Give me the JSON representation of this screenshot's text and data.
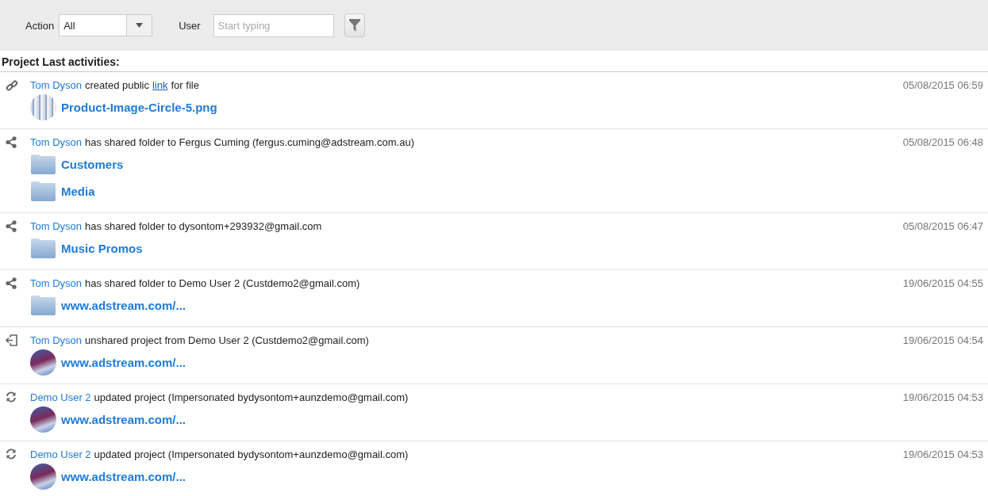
{
  "filters": {
    "action_label": "Action",
    "action_value": "All",
    "user_label": "User",
    "user_placeholder": "Start typing"
  },
  "section_title": "Project Last activities:",
  "activities": [
    {
      "kind": "link",
      "actor": "Tom Dyson",
      "message": [
        {
          "kind": "text",
          "text": "created public"
        },
        {
          "kind": "link",
          "text": "link"
        },
        {
          "kind": "text",
          "text": "for file"
        }
      ],
      "time": "05/08/2015 06:59",
      "items": [
        {
          "kind": "file",
          "name": "Product-Image-Circle-5.png"
        }
      ]
    },
    {
      "kind": "share",
      "actor": "Tom Dyson",
      "message": [
        {
          "kind": "text",
          "text": "has shared folder to Fergus Cuming (fergus.cuming@adstream.com.au)"
        }
      ],
      "time": "05/08/2015 06:48",
      "items": [
        {
          "kind": "folder",
          "name": "Customers"
        },
        {
          "kind": "folder",
          "name": "Media"
        }
      ]
    },
    {
      "kind": "share",
      "actor": "Tom Dyson",
      "message": [
        {
          "kind": "text",
          "text": "has shared folder to dysontom+293932@gmail.com"
        }
      ],
      "time": "05/08/2015 06:47",
      "items": [
        {
          "kind": "folder",
          "name": "Music Promos"
        }
      ]
    },
    {
      "kind": "share",
      "actor": "Tom Dyson",
      "message": [
        {
          "kind": "text",
          "text": "has shared folder to Demo User 2 (Custdemo2@gmail.com)"
        }
      ],
      "time": "19/06/2015 04:55",
      "items": [
        {
          "kind": "folder",
          "name": "www.adstream.com/..."
        }
      ]
    },
    {
      "kind": "unshare",
      "actor": "Tom Dyson",
      "message": [
        {
          "kind": "text",
          "text": "unshared project from Demo User 2 (Custdemo2@gmail.com)"
        }
      ],
      "time": "19/06/2015 04:54",
      "items": [
        {
          "kind": "project",
          "name": "www.adstream.com/..."
        }
      ]
    },
    {
      "kind": "update",
      "actor": "Demo User 2",
      "message": [
        {
          "kind": "text",
          "text": "updated project (Impersonated bydysontom+aunzdemo@gmail.com)"
        }
      ],
      "time": "19/06/2015 04:53",
      "items": [
        {
          "kind": "project",
          "name": "www.adstream.com/..."
        }
      ]
    },
    {
      "kind": "update",
      "actor": "Demo User 2",
      "message": [
        {
          "kind": "text",
          "text": "updated project (Impersonated bydysontom+aunzdemo@gmail.com)"
        }
      ],
      "time": "19/06/2015 04:53",
      "items": [
        {
          "kind": "project",
          "name": "www.adstream.com/..."
        }
      ]
    }
  ]
}
